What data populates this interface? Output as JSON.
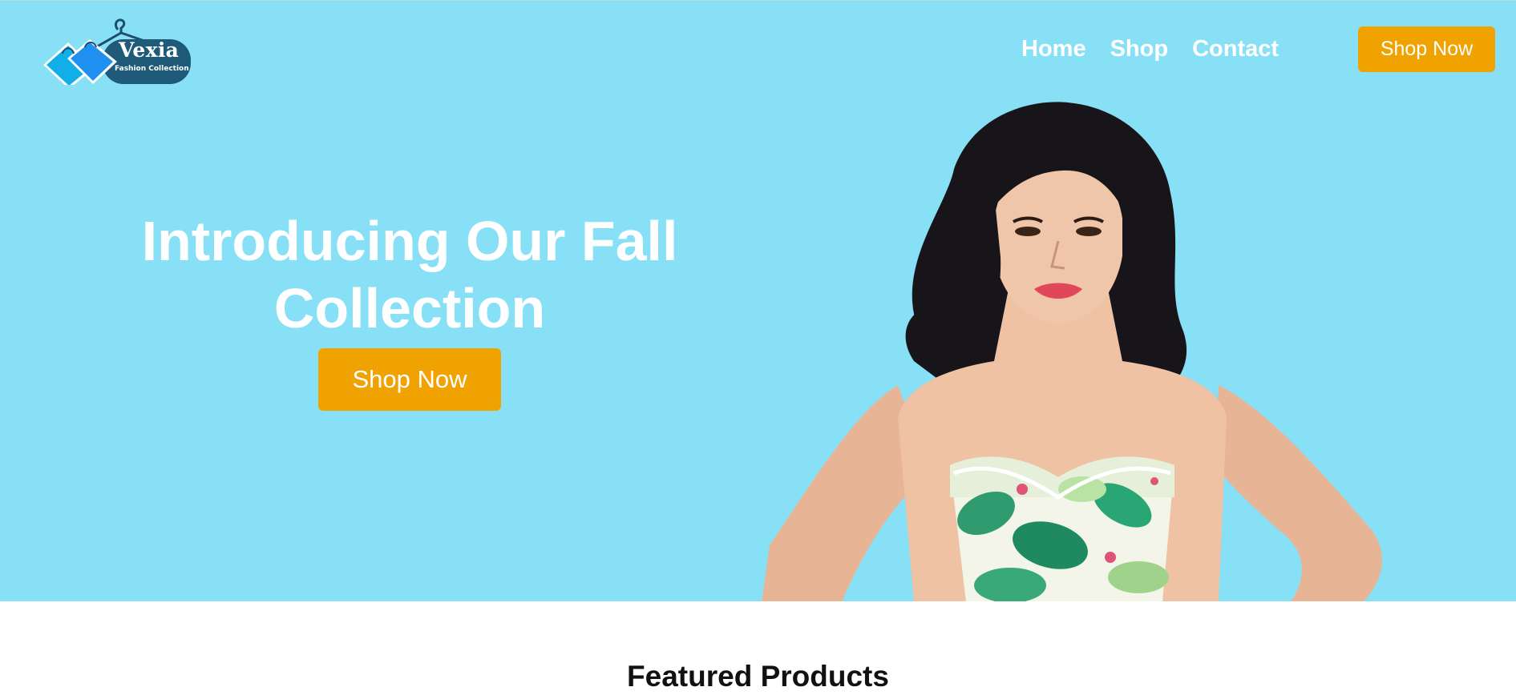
{
  "brand": {
    "name": "Vexia",
    "tagline": "Fashion Collection"
  },
  "nav": {
    "items": [
      "Home",
      "Shop",
      "Contact"
    ],
    "cta_label": "Shop Now"
  },
  "hero": {
    "headline": "Introducing Our Fall Collection",
    "cta_label": "Shop Now",
    "image_icon": "model-photo"
  },
  "featured": {
    "title": "Featured Products"
  },
  "colors": {
    "hero_bg": "#88e0f6",
    "accent": "#f0a300",
    "text_light": "#ffffff",
    "text_dark": "#111111"
  }
}
